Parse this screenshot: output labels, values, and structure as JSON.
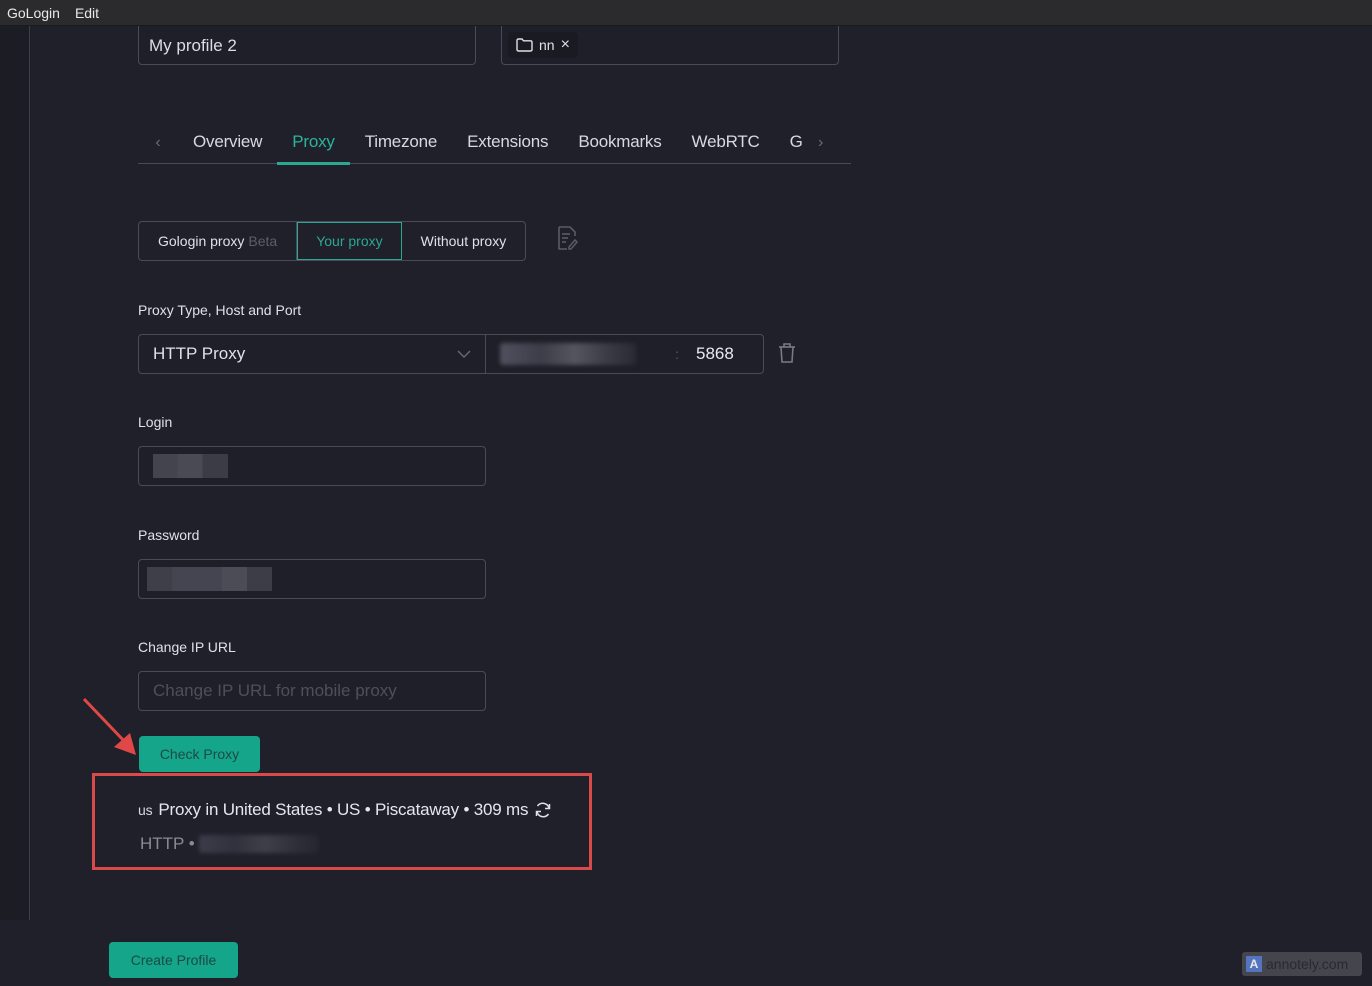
{
  "menubar": {
    "items": [
      "GoLogin",
      "Edit"
    ]
  },
  "profile": {
    "name": "My profile 2",
    "folder_tag": "nn",
    "folder_tag_icon": "folder-icon",
    "folder_tag_remove": "×"
  },
  "tabs": {
    "prev_arrow": "‹",
    "next_arrow": "›",
    "items": [
      {
        "label": "Overview",
        "active": false
      },
      {
        "label": "Proxy",
        "active": true
      },
      {
        "label": "Timezone",
        "active": false
      },
      {
        "label": "Extensions",
        "active": false
      },
      {
        "label": "Bookmarks",
        "active": false
      },
      {
        "label": "WebRTC",
        "active": false
      },
      {
        "label": "G",
        "active": false
      }
    ]
  },
  "proxy_mode": {
    "options": [
      {
        "label": "Gologin proxy",
        "badge": "Beta",
        "active": false
      },
      {
        "label": "Your proxy",
        "active": true
      },
      {
        "label": "Without proxy",
        "active": false
      }
    ],
    "notes_icon": "notes-edit-icon"
  },
  "proxy_config": {
    "label": "Proxy Type, Host and Port",
    "type_value": "HTTP Proxy",
    "host_value": "[redacted]",
    "port_separator": ":",
    "port_value": "5868",
    "delete_icon": "trash-icon"
  },
  "login": {
    "label": "Login",
    "value": "[redacted]"
  },
  "password": {
    "label": "Password",
    "value": "[redacted]"
  },
  "change_ip": {
    "label": "Change IP URL",
    "placeholder": "Change IP URL for mobile proxy",
    "value": ""
  },
  "check_button": {
    "label": "Check Proxy"
  },
  "check_result": {
    "country_code": "us",
    "summary": "Proxy in United States • US • Piscataway • 309 ms",
    "protocol": "HTTP •",
    "ip": "[redacted]",
    "refresh_icon": "refresh-icon"
  },
  "create_button": {
    "label": "Create Profile"
  },
  "annotation": {
    "highlight_color": "#d94a4a"
  },
  "watermark": {
    "text": "annotely.com",
    "logo": "A"
  },
  "colors": {
    "accent": "#2aa892",
    "button": "#14a58a",
    "background": "#20202b"
  }
}
